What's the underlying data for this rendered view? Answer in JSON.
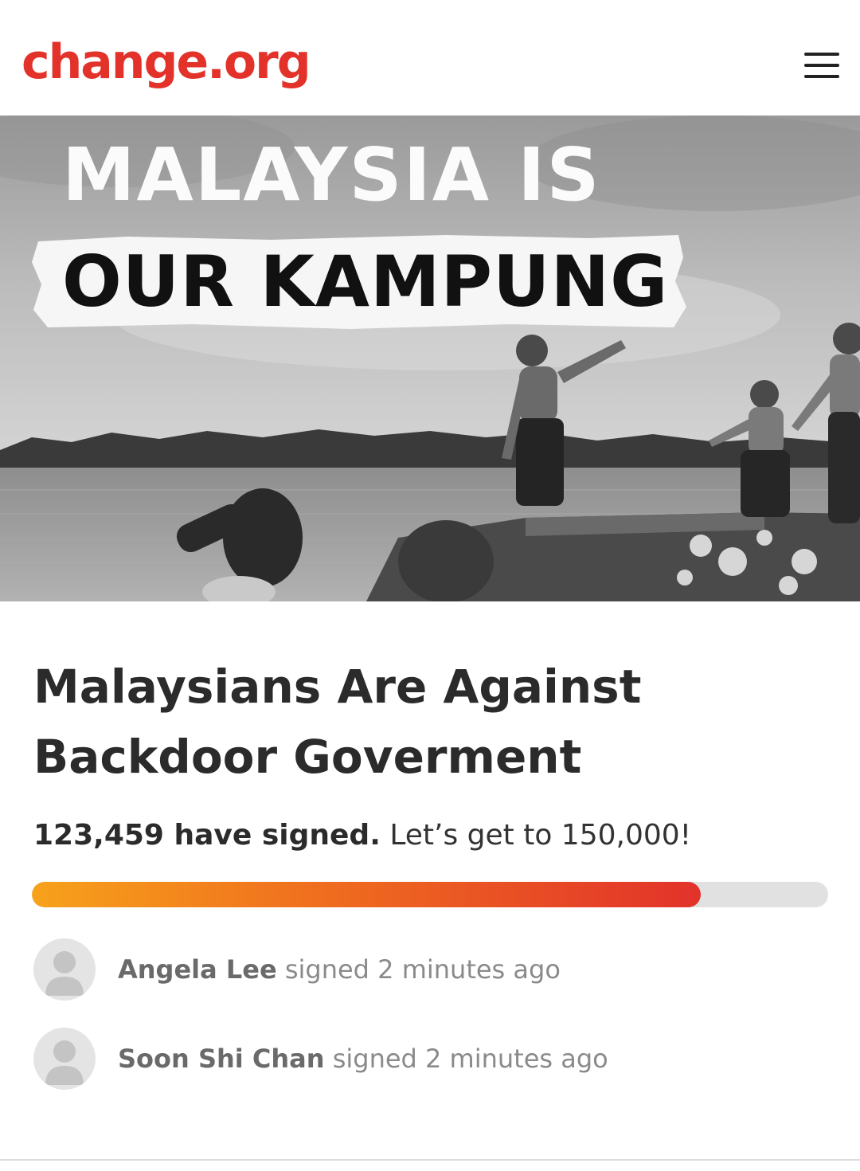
{
  "header": {
    "logo_text": "change.org",
    "brand_color": "#e2322a",
    "menu_icon": "hamburger-menu-icon"
  },
  "hero": {
    "line1": "MALAYSIA IS",
    "line2": "OUR KAMPUNG",
    "image_style": "black-and-white photo"
  },
  "petition": {
    "title": "Malaysians Are Against Backdoor Goverment",
    "signed_count": "123,459 have signed.",
    "goal_text": "Let’s get to 150,000!",
    "progress_fraction": 0.84
  },
  "recent_signers": [
    {
      "name": "Angela Lee",
      "action": "signed",
      "time": "2 minutes ago",
      "icon": "user-avatar-icon"
    },
    {
      "name": "Soon Shi Chan",
      "action": "signed",
      "time": "2 minutes ago",
      "icon": "user-avatar-icon"
    }
  ]
}
